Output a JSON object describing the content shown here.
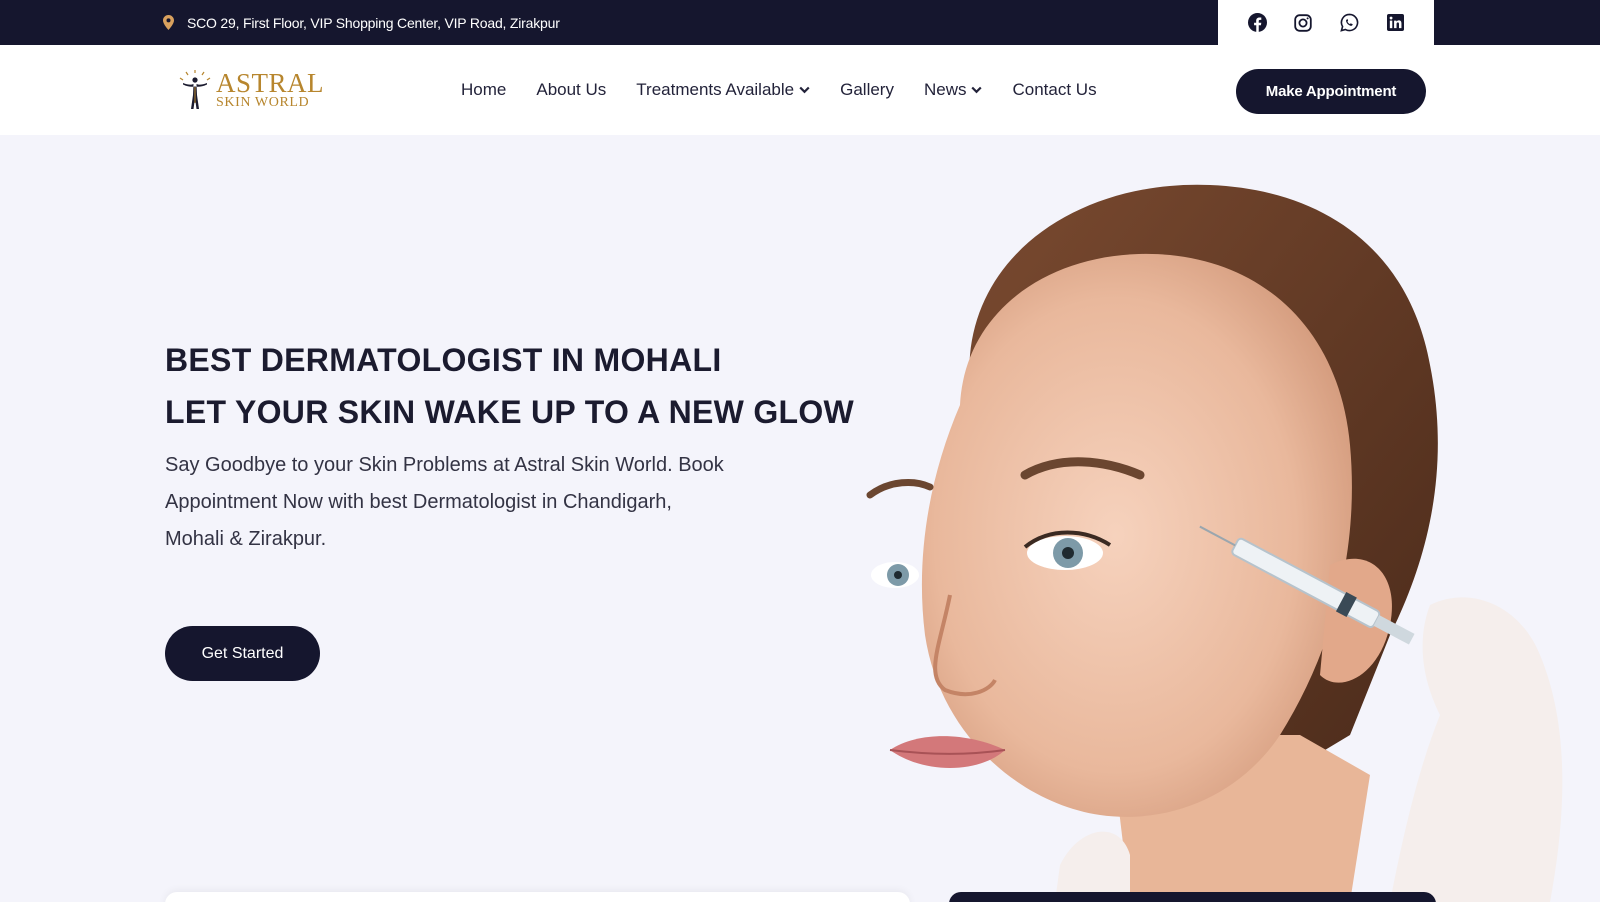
{
  "topbar": {
    "address": "SCO 29, First Floor, VIP Shopping Center, VIP Road, Zirakpur",
    "address_icon": "map-pin-icon",
    "accent_color": "#d9a15e",
    "social": [
      "facebook-icon",
      "instagram-icon",
      "whatsapp-icon",
      "linkedin-icon"
    ]
  },
  "header": {
    "logo": {
      "line1": "ASTRAL",
      "line2": "SKIN WORLD",
      "color": "#b7862e"
    },
    "nav": [
      {
        "label": "Home"
      },
      {
        "label": "About Us"
      },
      {
        "label": "Treatments Available",
        "dropdown": true
      },
      {
        "label": "Gallery"
      },
      {
        "label": "News",
        "dropdown": true
      },
      {
        "label": "Contact Us"
      }
    ],
    "cta": "Make Appointment"
  },
  "hero": {
    "heading_line1": "BEST DERMATOLOGIST IN MOHALI",
    "heading_line2": "LET YOUR SKIN WAKE UP TO A NEW GLOW",
    "description": "Say Goodbye to your Skin Problems at Astral Skin World. Book Appointment Now with best Dermatologist in Chandigarh, Mohali & Zirakpur.",
    "button": "Get Started"
  },
  "colors": {
    "primary": "#15162e",
    "background": "#f4f4fb",
    "text": "#1b1b2f"
  }
}
